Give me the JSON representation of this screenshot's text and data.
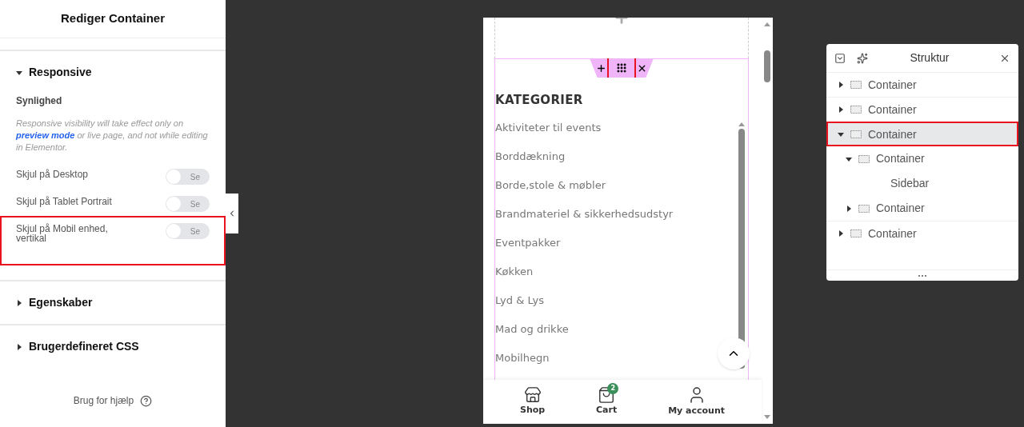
{
  "panel": {
    "title": "Rediger Container",
    "sections": [
      {
        "title": "Responsive",
        "expanded": true
      },
      {
        "title": "Egenskaber",
        "expanded": false
      },
      {
        "title": "Brugerdefineret CSS",
        "expanded": false
      }
    ],
    "subheading": "Synlighed",
    "note": {
      "before": "Responsive visibility will take effect only on",
      "link": "preview mode",
      "after": "or live page, and not while editing in Elementor."
    },
    "toggles": [
      {
        "label": "Skjul på Desktop",
        "on": false,
        "text": "Se",
        "highlighted": false
      },
      {
        "label": "Skjul på Tablet Portrait",
        "on": false,
        "text": "Se",
        "highlighted": false
      },
      {
        "label": "Skjul på Mobil enhed, vertikal",
        "on": false,
        "text": "Se",
        "highlighted": true
      }
    ],
    "help": "Brug for hjælp"
  },
  "preview": {
    "handle_highlighted": true,
    "heading": "KATEGORIER",
    "categories": [
      "Aktiviteter til events",
      "Borddækning",
      "Borde,stole & møbler",
      "Brandmateriel & sikkerhedsudstyr",
      "Eventpakker",
      "Køkken",
      "Lyd & Lys",
      "Mad og drikke",
      "Mobilhegn"
    ],
    "nav": [
      {
        "kind": "shop",
        "label": "Shop"
      },
      {
        "kind": "cart",
        "label": "Cart",
        "badge": "2"
      },
      {
        "kind": "account",
        "label": "My account"
      }
    ]
  },
  "structure": {
    "title": "Struktur",
    "items": [
      {
        "label": "Container",
        "expanded": false,
        "selected": false
      },
      {
        "label": "Container",
        "expanded": false,
        "selected": false
      },
      {
        "label": "Container",
        "expanded": true,
        "selected": true,
        "children": [
          {
            "label": "Container",
            "expanded": true,
            "selected": false,
            "children": [
              {
                "label": "Sidebar",
                "kind": "widget",
                "selected": false
              }
            ]
          },
          {
            "label": "Container",
            "expanded": false,
            "selected": false
          }
        ]
      },
      {
        "label": "Container",
        "expanded": false,
        "selected": false
      }
    ]
  }
}
